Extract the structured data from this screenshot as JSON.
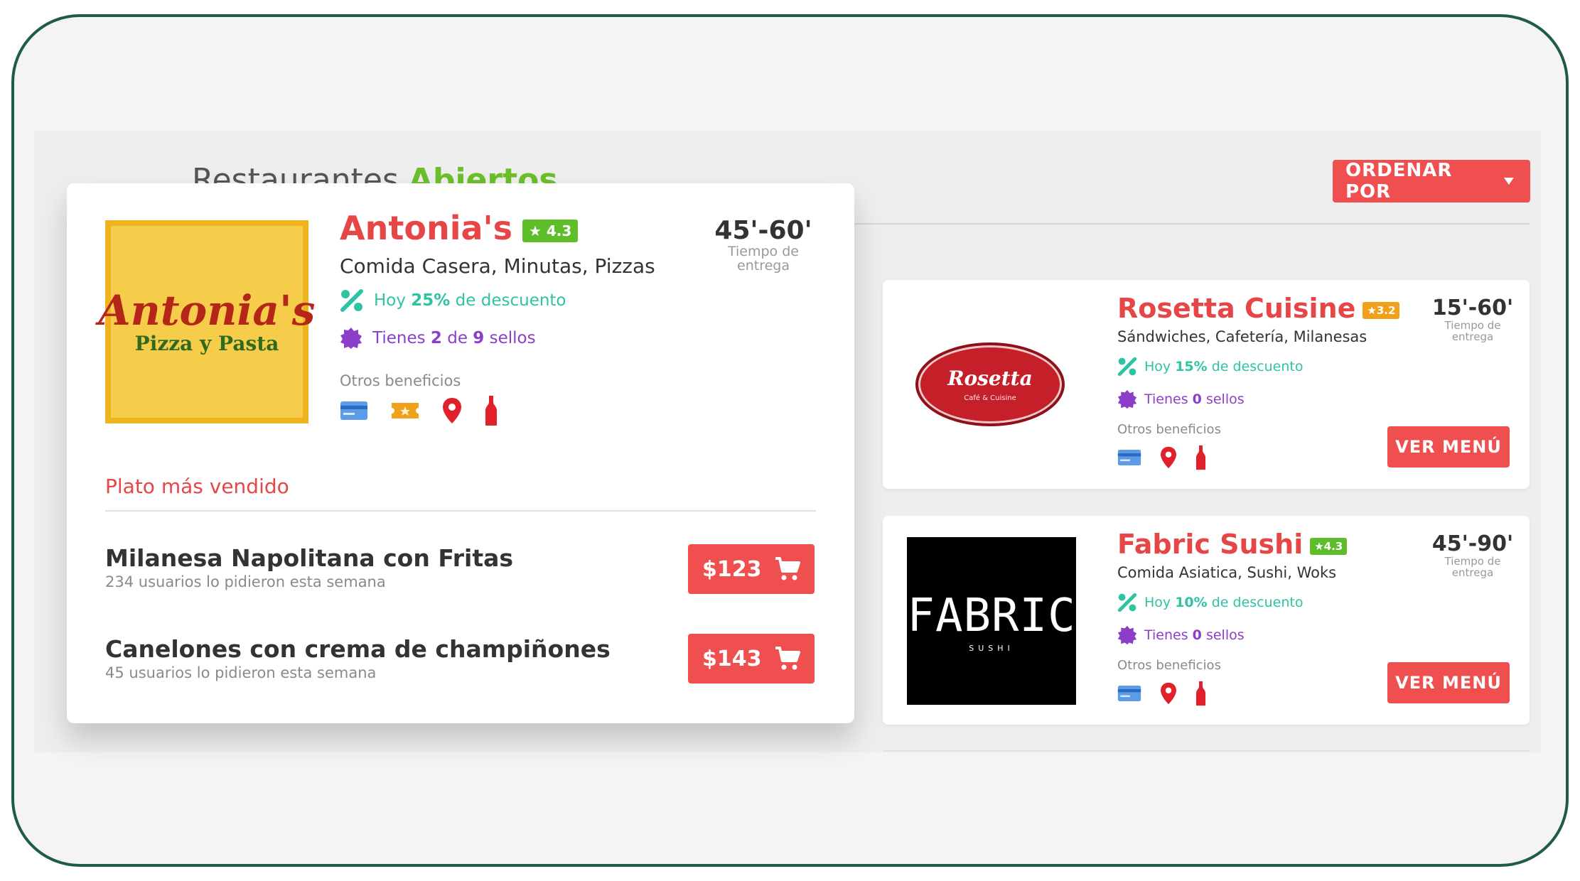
{
  "section": {
    "title_prefix": "Restaurantes",
    "title_accent": "Abiertos"
  },
  "sort_button": {
    "label": "ORDENAR POR"
  },
  "featured": {
    "name": "Antonia's",
    "rating": "★ 4.3",
    "logo": {
      "line1": "Antonia's",
      "line2": "Pizza y Pasta"
    },
    "cuisine": "Comida Casera, Minutas, Pizzas",
    "discount": {
      "pre": "Hoy",
      "value": "25%",
      "post": "de descuento"
    },
    "stamps": {
      "pre": "Tienes",
      "have": "2",
      "mid": "de",
      "total": "9",
      "post": "sellos"
    },
    "other_benefits": "Otros beneficios",
    "time": {
      "value": "45'-60'",
      "label": "Tiempo de entrega"
    },
    "best_seller_label": "Plato más vendido",
    "dishes": [
      {
        "name": "Milanesa Napolitana con Fritas",
        "sub": "234 usuarios lo pidieron esta semana",
        "price": "$123"
      },
      {
        "name": "Canelones con crema de champiñones",
        "sub": "45 usuarios lo pidieron esta semana",
        "price": "$143"
      }
    ]
  },
  "restaurants": [
    {
      "name": "Rosetta Cuisine",
      "rating": "★3.2",
      "logo": {
        "line1": "Rosetta",
        "line2": "Café & Cuisine"
      },
      "cuisine": "Sándwiches, Cafetería, Milanesas",
      "discount": {
        "pre": "Hoy",
        "value": "15%",
        "post": "de descuento"
      },
      "stamps": {
        "pre": "Tienes",
        "have": "0",
        "post": "sellos"
      },
      "other_benefits": "Otros beneficios",
      "time": {
        "value": "15'-60'",
        "label": "Tiempo de entrega"
      },
      "menu_label": "VER MENÚ"
    },
    {
      "name": "Fabric Sushi",
      "rating": "★4.3",
      "logo": {
        "line1": "FABRIC",
        "line2": "SUSHI"
      },
      "cuisine": "Comida Asiatica, Sushi, Woks",
      "discount": {
        "pre": "Hoy",
        "value": "10%",
        "post": "de descuento"
      },
      "stamps": {
        "pre": "Tienes",
        "have": "0",
        "post": "sellos"
      },
      "other_benefits": "Otros beneficios",
      "time": {
        "value": "45'-90'",
        "label": "Tiempo de entrega"
      },
      "menu_label": "VER MENÚ"
    }
  ],
  "icons": {
    "discount": "percent-icon",
    "stamp": "badge-icon",
    "card": "credit-card-icon",
    "ticket": "ticket-icon",
    "location": "location-pin-icon",
    "drink": "bottle-icon",
    "cart": "cart-icon",
    "dropdown": "caret-down-icon"
  },
  "colors": {
    "accent_red": "#ef4f4f",
    "name_red": "#e64646",
    "green": "#6bbf2a",
    "teal": "#2fc3a3",
    "purple": "#8b3fc9",
    "frame": "#1f5a4c"
  }
}
